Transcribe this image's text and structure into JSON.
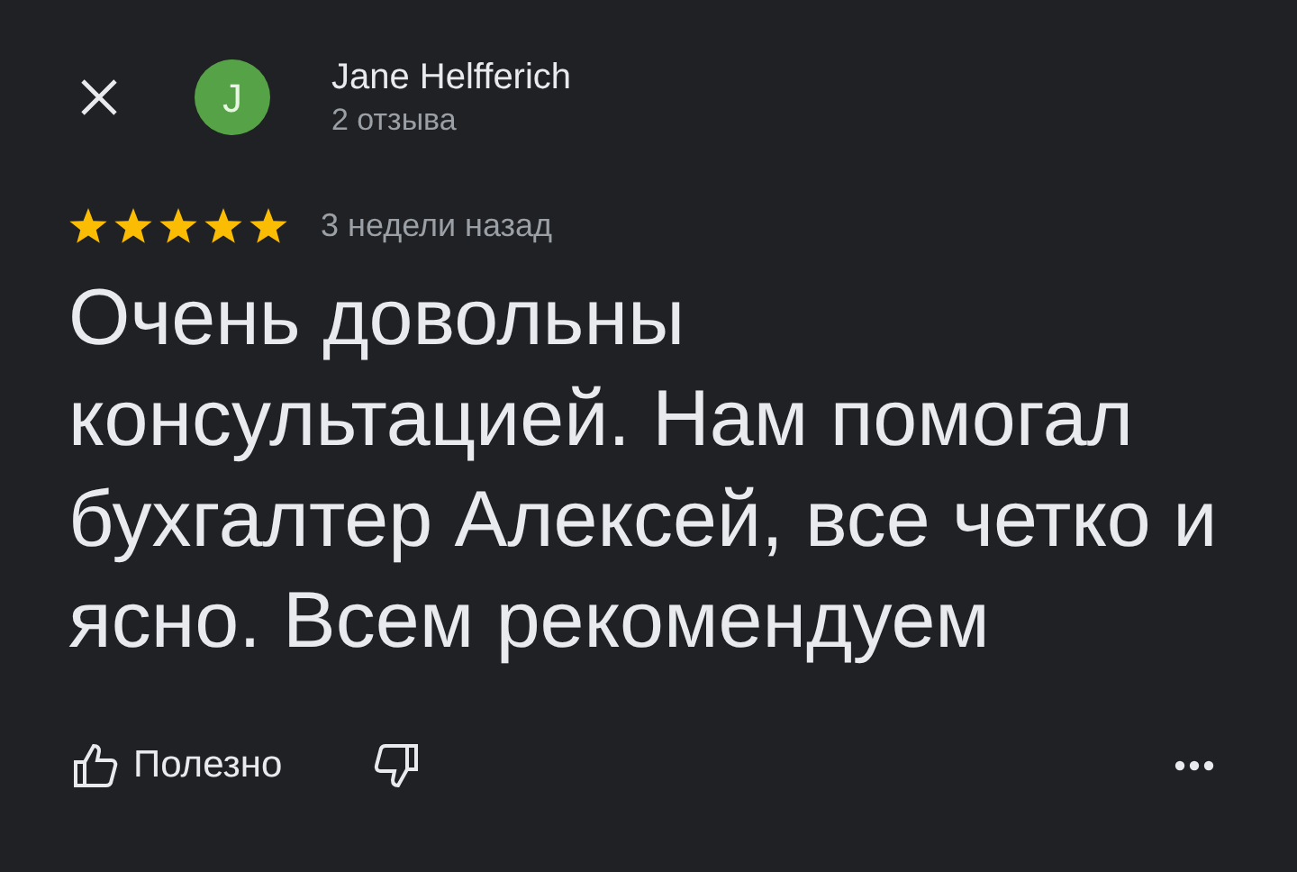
{
  "reviewer": {
    "initial": "J",
    "name": "Jane Helfferich",
    "reviews": "2 отзыва"
  },
  "rating": {
    "stars": 5,
    "time": "3 недели назад"
  },
  "review_text": "Очень довольны консультацией. Нам помогал бухгалтер Алексей, все четко и ясно. Всем рекомендуем",
  "actions": {
    "helpful": "Полезно"
  }
}
